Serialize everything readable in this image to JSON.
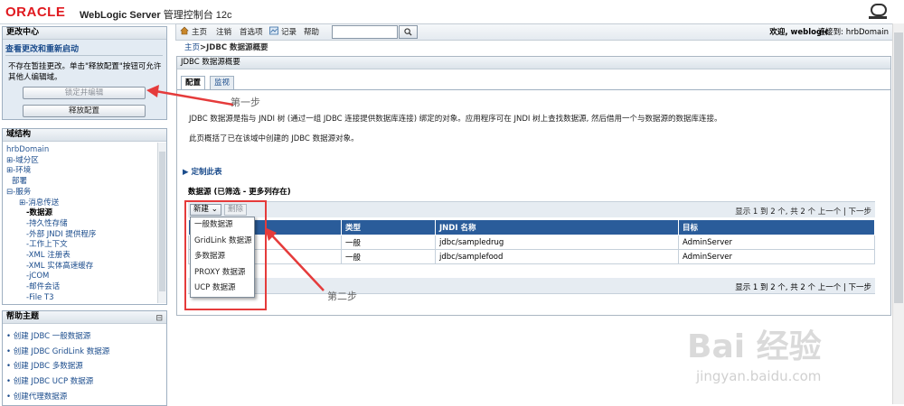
{
  "header": {
    "logo": "ORACLE",
    "product_bold": "WebLogic Server",
    "product_rest": " 管理控制台 12c"
  },
  "change_center": {
    "title": "更改中心",
    "subtitle": "查看更改和重新启动",
    "message": "不存在暂挂更改。单击\"释放配置\"按钮可允许其他人编辑域。",
    "lock_button": "锁定并编辑",
    "release_button": "释放配置"
  },
  "domain_panel": {
    "title": "域结构",
    "tree": [
      "hrbDomain",
      "⊞-域分区",
      "⊞-环境",
      "  部署",
      "⊟-服务",
      "  ⊞-消息传送",
      "    -数据源",
      "    -持久性存储",
      "    -外部 JNDI 提供程序",
      "    -工作上下文",
      "    -XML 注册表",
      "    -XML 实体高速缓存",
      "    -jCOM",
      "    -邮件会话",
      "    -File T3"
    ]
  },
  "help_panel": {
    "title": "帮助主题",
    "collapse": "⊟",
    "items": [
      "创建 JDBC 一般数据源",
      "创建 JDBC GridLink 数据源",
      "创建 JDBC 多数据源",
      "创建 JDBC UCP 数据源",
      "创建代理数据源"
    ]
  },
  "topnav": {
    "home": "主页",
    "logout": "注销",
    "prefs": "首选项",
    "record": "记录",
    "help": "帮助",
    "search_value": "",
    "welcome": "欢迎, weblogic",
    "connected": "连接到: hrbDomain"
  },
  "breadcrumb": {
    "home": "主页",
    "current": ">JDBC 数据源概要"
  },
  "main": {
    "title": "JDBC 数据源概要",
    "tabs": [
      "配置",
      "监视"
    ],
    "desc1": "JDBC 数据源是指与 JNDI 树 (通过一组 JDBC 连接提供数据库连接) 绑定的对象。应用程序可在 JNDI 树上查找数据源, 然后借用一个与数据源的数据库连接。",
    "desc2": "此页概括了已在该域中创建的 JDBC 数据源对象。",
    "customize": "定制此表",
    "table_heading": "数据源 (已筛选 - 更多列存在)",
    "new_button": "新建",
    "delete_button": "删除",
    "page_info": "显示 1 到 2 个, 共 2 个   上一个 | 下一步",
    "columns": [
      "",
      "类型",
      "JNDI 名称",
      "目标"
    ],
    "rows": [
      [
        "",
        "一般",
        "jdbc/sampledrug",
        "AdminServer"
      ],
      [
        "",
        "一般",
        "jdbc/samplefood",
        "AdminServer"
      ]
    ]
  },
  "new_menu": [
    "一般数据源",
    "GridLink 数据源",
    "多数据源",
    "PROXY 数据源",
    "UCP 数据源"
  ],
  "annotations": {
    "step1": "第一步",
    "step2": "第二步",
    "color": "#e53b3b"
  },
  "watermark": {
    "line1": "Bai 经验",
    "line2": "jingyan.baidu.com"
  }
}
